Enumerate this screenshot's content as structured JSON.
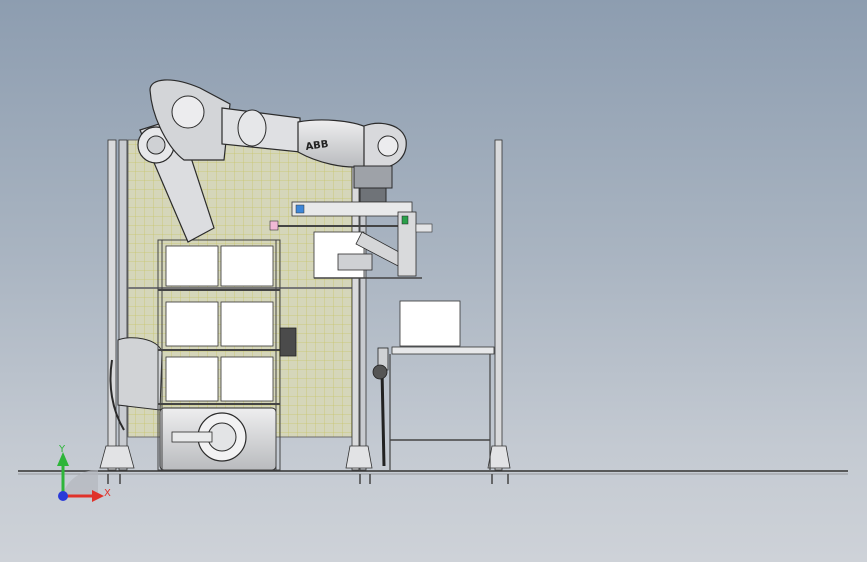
{
  "triad": {
    "x_label": "X",
    "y_label": "Y",
    "x_color": "#e0322a",
    "y_color": "#2eb53a",
    "z_color": "#2a3ad8"
  },
  "robot": {
    "logo_text": "ABB",
    "body_color": "#d9dadc",
    "outline_color": "#2b2b2b"
  },
  "colors": {
    "fence_frame": "#c8cbd0",
    "fence_mesh": "#c9c77a",
    "panel_white": "#ffffff",
    "floor_line": "#333333"
  }
}
